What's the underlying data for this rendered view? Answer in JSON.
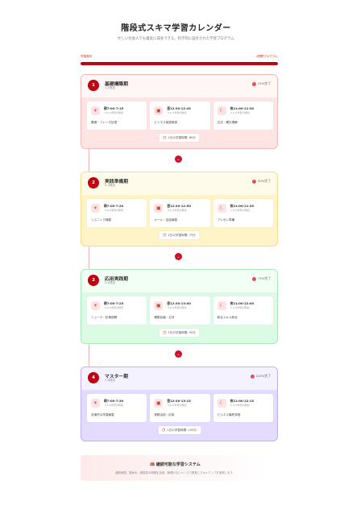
{
  "header": {
    "title": "階段式スキマ学習カレンダー",
    "subtitle": "忙しい社会人でも着実に成長できる、科学的に設計された学習プログラム"
  },
  "progress": {
    "left_label": "学習進捗",
    "right_label": "4週間プログラム",
    "value": 1.0
  },
  "phases": [
    {
      "num": "1",
      "name": "基礎構築期",
      "weeks": "1-2週目",
      "pct": "25%完了",
      "slots": [
        {
          "icon": "sun-icon",
          "glyph": "☀",
          "time": "朝7:00-7:15",
          "note": "スキマ学習の時間",
          "task": "基礎・フレーズ記憶"
        },
        {
          "icon": "briefcase-icon",
          "glyph": "▣",
          "time": "昼12:30-12:45",
          "note": "スキマ学習の時間",
          "task": "ビジネス英語単語"
        },
        {
          "icon": "moon-icon",
          "glyph": "☾",
          "time": "夜21:00-21:30",
          "note": "スキマ学習の時間",
          "task": "文法・構文理解"
        }
      ],
      "total": "1日の学習時間: 60分"
    },
    {
      "num": "2",
      "name": "実践準備期",
      "weeks": "3-4週目",
      "pct": "50%完了",
      "slots": [
        {
          "icon": "sun-icon",
          "glyph": "☀",
          "time": "朝7:00-7:20",
          "note": "スキマ学習の時間",
          "task": "リスニング練習"
        },
        {
          "icon": "briefcase-icon",
          "glyph": "▣",
          "time": "昼12:30-12:50",
          "note": "スキマ学習の時間",
          "task": "メール・会話練習"
        },
        {
          "icon": "moon-icon",
          "glyph": "☾",
          "time": "夜21:00-21:35",
          "note": "スキマ学習の時間",
          "task": "プレゼン準備"
        }
      ],
      "total": "1日の学習時間: 75分"
    },
    {
      "num": "3",
      "name": "応用実践期",
      "weeks": "5-6週目",
      "pct": "75%完了",
      "slots": [
        {
          "icon": "sun-icon",
          "glyph": "☀",
          "time": "朝7:00-7:25",
          "note": "スキマ学習の時間",
          "task": "ニュース・記事読解"
        },
        {
          "icon": "briefcase-icon",
          "glyph": "▣",
          "time": "昼12:30-13:00",
          "note": "スキマ学習の時間",
          "task": "模擬会議・交渉"
        },
        {
          "icon": "moon-icon",
          "glyph": "☾",
          "time": "夜21:00-22:00",
          "note": "スキマ学習の時間",
          "task": "総合スキル統合"
        }
      ],
      "total": "1日の学習時間: 90分"
    },
    {
      "num": "4",
      "name": "マスター期",
      "weeks": "7-8週目",
      "pct": "100%完了",
      "slots": [
        {
          "icon": "sun-icon",
          "glyph": "☀",
          "time": "朝7:00-7:30",
          "note": "スキマ学習の時間",
          "task": "自律的な学習練習"
        },
        {
          "icon": "briefcase-icon",
          "glyph": "▣",
          "time": "昼12:30-13:15",
          "note": "スキマ学習の時間",
          "task": "実務活用・応用"
        },
        {
          "icon": "moon-icon",
          "glyph": "☾",
          "time": "夜21:00-22:15",
          "note": "スキマ学習の時間",
          "task": "ビジネス最終評価"
        }
      ],
      "total": "1日の学習時間: 105分"
    }
  ],
  "footer": {
    "title": "継続可能な学習システム",
    "text": "通勤時間、昼休み、就寝前の時間を活用。無理のないペースで着実にスキルアップを実現します。"
  },
  "colors": {
    "accent": "#c00010",
    "phase1_bg": "#ffe4e4",
    "phase2_bg": "#fff3c8",
    "phase3_bg": "#dcfbe4",
    "phase4_bg": "#e3dcff"
  }
}
